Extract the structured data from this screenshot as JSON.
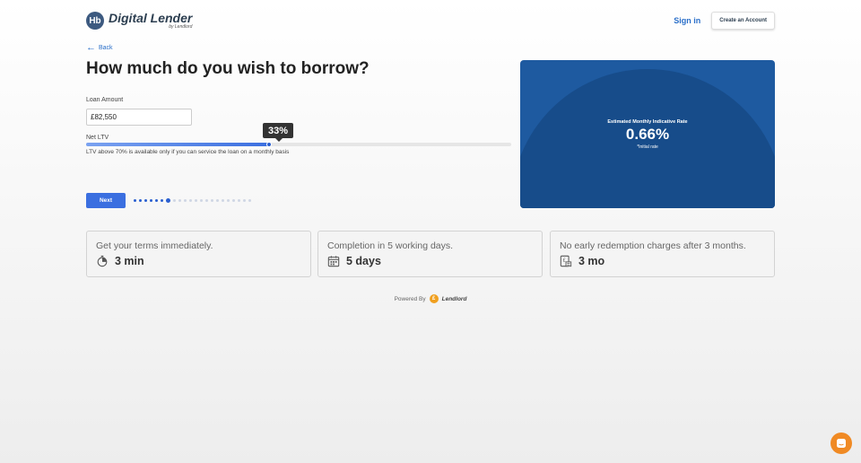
{
  "header": {
    "logo_title": "Digital Lender",
    "logo_sub": "by Lendlord",
    "logo_mark": "Hb",
    "signin_label": "Sign in",
    "create_label": "Create an Account"
  },
  "nav": {
    "back_label": "Back"
  },
  "main": {
    "title": "How much do you wish to borrow?",
    "loan_label": "Loan Amount",
    "loan_value": "£82,550",
    "ltv_label": "Net LTV",
    "ltv_tooltip": "33%",
    "ltv_fraction": 0.43,
    "ltv_note": "LTV above 70% is available only if you can service the loan on a monthly basis",
    "next_label": "Next",
    "steps_total": 22,
    "steps_current": 7
  },
  "rate_card": {
    "label": "Estimated Monthly Indicative Rate",
    "value": "0.66%",
    "sub": "*Initial rate"
  },
  "features": [
    {
      "title": "Get your terms immediately.",
      "value": "3 min",
      "icon": "stopwatch-icon"
    },
    {
      "title": "Completion in 5 working days.",
      "value": "5 days",
      "icon": "calendar-icon"
    },
    {
      "title": "No early redemption charges after 3 months.",
      "value": "3 mo",
      "icon": "document-pound-icon"
    }
  ],
  "footer": {
    "powered_label": "Powered By",
    "brand": "Lendlord",
    "brand_mark": "£"
  },
  "colors": {
    "accent": "#3b6fe0",
    "link": "#2a6fc9",
    "card": "#1e5aa0",
    "chat": "#f08a24"
  }
}
